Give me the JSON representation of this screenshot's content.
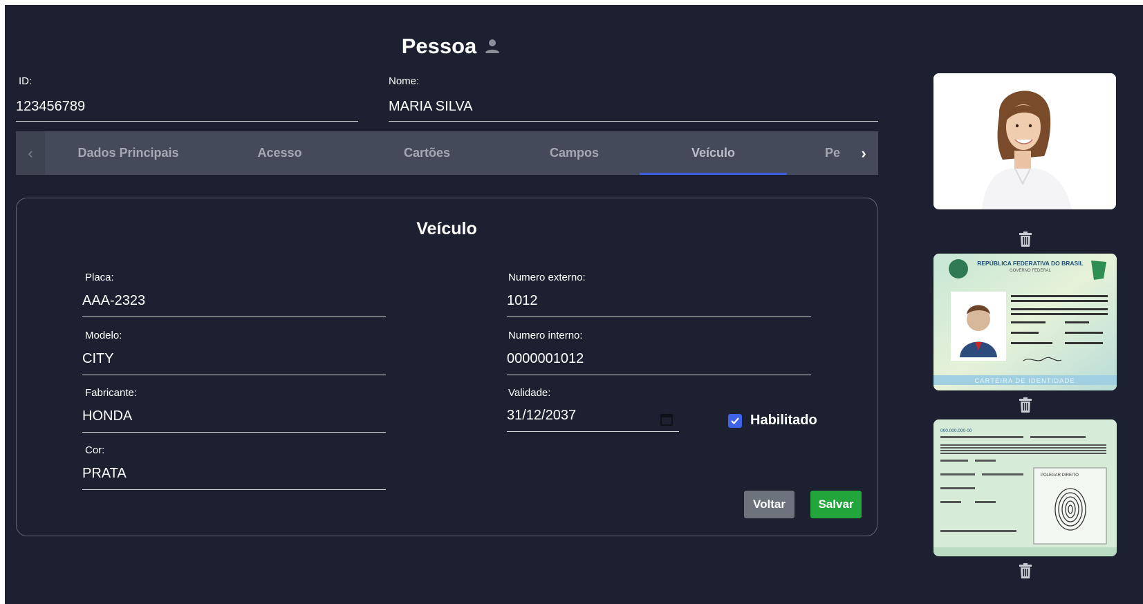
{
  "header": {
    "title": "Pessoa",
    "title_icon": "person-icon"
  },
  "fields": {
    "id": {
      "label": "ID:",
      "value": "123456789"
    },
    "nome": {
      "label": "Nome:",
      "value": "MARIA SILVA"
    }
  },
  "tabs": {
    "prev_icon": "chevron-left-icon",
    "next_icon": "chevron-right-icon",
    "items": [
      {
        "label": "Dados Principais"
      },
      {
        "label": "Acesso"
      },
      {
        "label": "Cartões"
      },
      {
        "label": "Campos"
      },
      {
        "label": "Veículo"
      },
      {
        "label": "Pe"
      }
    ],
    "active": "Veículo"
  },
  "vehicle": {
    "title": "Veículo",
    "placa": {
      "label": "Placa:",
      "value": "AAA-2323"
    },
    "modelo": {
      "label": "Modelo:",
      "value": "CITY"
    },
    "fabricante": {
      "label": "Fabricante:",
      "value": "HONDA"
    },
    "cor": {
      "label": "Cor:",
      "value": "PRATA"
    },
    "numero_externo": {
      "label": "Numero externo:",
      "value": "1012"
    },
    "numero_interno": {
      "label": "Numero interno:",
      "value": "0000001012"
    },
    "validade": {
      "label": "Validade:",
      "value": "31/12/2037"
    },
    "habilitado": {
      "label": "Habilitado",
      "checked": true
    }
  },
  "buttons": {
    "back": "Voltar",
    "save": "Salvar"
  },
  "sidebar": {
    "id_card": {
      "country": "REPÚBLICA FEDERATIVA DO BRASIL",
      "gov": "GOVERNO FEDERAL",
      "footer": "CARTEIRA DE IDENTIDADE"
    },
    "doc_back": {
      "cpf": "000.000.000-00",
      "polegar": "POLEGAR DIREITO"
    }
  },
  "colors": {
    "background": "#1c2030",
    "tab_bar": "#444a59",
    "tab_indicator": "#3d5ce0",
    "checkbox": "#3f63e6",
    "save_button": "#22a63b",
    "back_button": "#6c737d"
  }
}
